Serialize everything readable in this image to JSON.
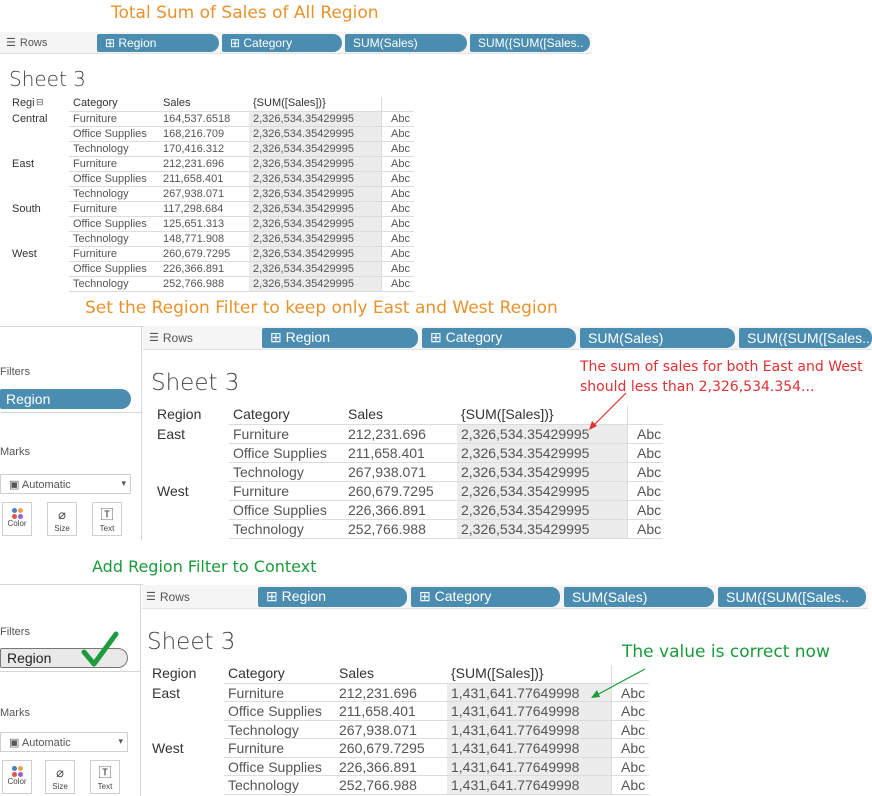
{
  "captions": {
    "step1": "Total Sum of Sales of All Region",
    "step2": "Set the Region Filter to keep only East and West Region",
    "step3": "Add Region Filter to Context"
  },
  "shelf": {
    "label": "Rows",
    "pills": [
      "⊞ Region",
      "⊞ Category",
      "SUM(Sales)",
      "SUM({SUM([Sales..",
      "SUM({SUM([Sales..",
      "SUM({SUM([Sales.."
    ]
  },
  "sheet_title": "Sheet 3",
  "table": {
    "headers": [
      "Region",
      "Category",
      "Sales",
      "{SUM([Sales])}"
    ],
    "first_header_short": "Regi",
    "abc": "Abc",
    "panel1_rows": [
      {
        "region": "Central",
        "category": "Furniture",
        "sales": "164,537.6518",
        "total": "2,326,534.35429995"
      },
      {
        "region": "",
        "category": "Office Supplies",
        "sales": "168,216.709",
        "total": "2,326,534.35429995"
      },
      {
        "region": "",
        "category": "Technology",
        "sales": "170,416.312",
        "total": "2,326,534.35429995"
      },
      {
        "region": "East",
        "category": "Furniture",
        "sales": "212,231.696",
        "total": "2,326,534.35429995"
      },
      {
        "region": "",
        "category": "Office Supplies",
        "sales": "211,658.401",
        "total": "2,326,534.35429995"
      },
      {
        "region": "",
        "category": "Technology",
        "sales": "267,938.071",
        "total": "2,326,534.35429995"
      },
      {
        "region": "South",
        "category": "Furniture",
        "sales": "117,298.684",
        "total": "2,326,534.35429995"
      },
      {
        "region": "",
        "category": "Office Supplies",
        "sales": "125,651.313",
        "total": "2,326,534.35429995"
      },
      {
        "region": "",
        "category": "Technology",
        "sales": "148,771.908",
        "total": "2,326,534.35429995"
      },
      {
        "region": "West",
        "category": "Furniture",
        "sales": "260,679.7295",
        "total": "2,326,534.35429995"
      },
      {
        "region": "",
        "category": "Office Supplies",
        "sales": "226,366.891",
        "total": "2,326,534.35429995"
      },
      {
        "region": "",
        "category": "Technology",
        "sales": "252,766.988",
        "total": "2,326,534.35429995"
      }
    ],
    "panel2_rows": [
      {
        "region": "East",
        "category": "Furniture",
        "sales": "212,231.696",
        "total": "2,326,534.35429995"
      },
      {
        "region": "",
        "category": "Office Supplies",
        "sales": "211,658.401",
        "total": "2,326,534.35429995"
      },
      {
        "region": "",
        "category": "Technology",
        "sales": "267,938.071",
        "total": "2,326,534.35429995"
      },
      {
        "region": "West",
        "category": "Furniture",
        "sales": "260,679.7295",
        "total": "2,326,534.35429995"
      },
      {
        "region": "",
        "category": "Office Supplies",
        "sales": "226,366.891",
        "total": "2,326,534.35429995"
      },
      {
        "region": "",
        "category": "Technology",
        "sales": "252,766.988",
        "total": "2,326,534.35429995"
      }
    ],
    "panel3_rows": [
      {
        "region": "East",
        "category": "Furniture",
        "sales": "212,231.696",
        "total": "1,431,641.77649998"
      },
      {
        "region": "",
        "category": "Office Supplies",
        "sales": "211,658.401",
        "total": "1,431,641.77649998"
      },
      {
        "region": "",
        "category": "Technology",
        "sales": "267,938.071",
        "total": "1,431,641.77649998"
      },
      {
        "region": "West",
        "category": "Furniture",
        "sales": "260,679.7295",
        "total": "1,431,641.77649998"
      },
      {
        "region": "",
        "category": "Office Supplies",
        "sales": "226,366.891",
        "total": "1,431,641.77649998"
      },
      {
        "region": "",
        "category": "Technology",
        "sales": "252,766.988",
        "total": "1,431,641.77649998"
      }
    ]
  },
  "side_panel": {
    "filters_label": "Filters",
    "filter_pill": "Region",
    "marks_label": "Marks",
    "mark_type": "Automatic",
    "buttons": [
      "Color",
      "Size",
      "Text"
    ]
  },
  "notes": {
    "red_line1": "The sum of sales for both East and West",
    "red_line2": "should less than 2,326,534.354...",
    "green": "The value is correct now"
  },
  "colors": {
    "pill": "#4a8db0",
    "caption_orange": "#e8922c",
    "caption_green": "#1a9a3a",
    "note_red": "#e03030"
  }
}
